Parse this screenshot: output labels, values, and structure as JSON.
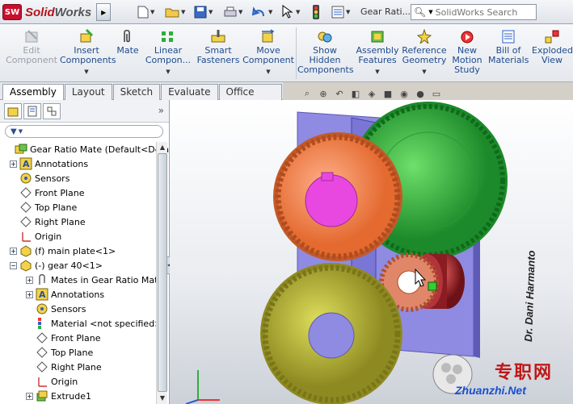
{
  "titlebar": {
    "logo_badge": "SW",
    "brand_main": "Solid",
    "brand_bold": "Works",
    "doc_title": "Gear Rati...",
    "search_placeholder": "SolidWorks Search"
  },
  "commands": [
    {
      "id": "edit-component",
      "label1": "Edit",
      "label2": "Component",
      "disabled": true
    },
    {
      "id": "insert-components",
      "label1": "Insert",
      "label2": "Components"
    },
    {
      "id": "mate",
      "label1": "Mate",
      "label2": ""
    },
    {
      "id": "linear-component",
      "label1": "Linear",
      "label2": "Compon..."
    },
    {
      "id": "smart-fasteners",
      "label1": "Smart",
      "label2": "Fasteners"
    },
    {
      "id": "move-component",
      "label1": "Move",
      "label2": "Component"
    },
    {
      "id": "show-hidden-components",
      "label1": "Show",
      "label2": "Hidden",
      "label3": "Components"
    },
    {
      "id": "assembly-features",
      "label1": "Assembly",
      "label2": "Features"
    },
    {
      "id": "reference-geometry",
      "label1": "Reference",
      "label2": "Geometry"
    },
    {
      "id": "new-motion-study",
      "label1": "New",
      "label2": "Motion",
      "label3": "Study"
    },
    {
      "id": "bill-of-materials",
      "label1": "Bill of",
      "label2": "Materials"
    },
    {
      "id": "exploded-view",
      "label1": "Exploded",
      "label2": "View"
    }
  ],
  "tabs": [
    "Assembly",
    "Layout",
    "Sketch",
    "Evaluate",
    "Office Products"
  ],
  "panel": {
    "collapse_glyph": "»"
  },
  "tree": [
    {
      "label": "Gear Ratio Mate  (Default<Default",
      "icon": "assembly",
      "indent": 0,
      "exp": ""
    },
    {
      "label": "Annotations",
      "icon": "annotation",
      "indent": 1,
      "exp": "+"
    },
    {
      "label": "Sensors",
      "icon": "sensor",
      "indent": 1,
      "exp": ""
    },
    {
      "label": "Front Plane",
      "icon": "plane",
      "indent": 1,
      "exp": ""
    },
    {
      "label": "Top Plane",
      "icon": "plane",
      "indent": 1,
      "exp": ""
    },
    {
      "label": "Right Plane",
      "icon": "plane",
      "indent": 1,
      "exp": ""
    },
    {
      "label": "Origin",
      "icon": "origin",
      "indent": 1,
      "exp": ""
    },
    {
      "label": "(f) main plate<1>",
      "icon": "part",
      "indent": 1,
      "exp": "+"
    },
    {
      "label": "(-) gear 40<1>",
      "icon": "part",
      "indent": 1,
      "exp": "−"
    },
    {
      "label": "Mates in Gear Ratio Mate",
      "icon": "mates",
      "indent": 2,
      "exp": "+"
    },
    {
      "label": "Annotations",
      "icon": "annotation",
      "indent": 2,
      "exp": "+"
    },
    {
      "label": "Sensors",
      "icon": "sensor",
      "indent": 2,
      "exp": ""
    },
    {
      "label": "Material <not specified>",
      "icon": "material",
      "indent": 2,
      "exp": ""
    },
    {
      "label": "Front Plane",
      "icon": "plane",
      "indent": 2,
      "exp": ""
    },
    {
      "label": "Top Plane",
      "icon": "plane",
      "indent": 2,
      "exp": ""
    },
    {
      "label": "Right Plane",
      "icon": "plane",
      "indent": 2,
      "exp": ""
    },
    {
      "label": "Origin",
      "icon": "origin",
      "indent": 2,
      "exp": ""
    },
    {
      "label": "Extrude1",
      "icon": "extrude",
      "indent": 2,
      "exp": "+"
    }
  ],
  "viewport": {
    "signature": "Dr. Dani Harmanto",
    "colors": {
      "gear_orange": "#f0844c",
      "gear_green": "#2fae3c",
      "gear_olive": "#b8b236",
      "gear_small": "#e0876a",
      "plate": "#8a86e0",
      "pinion": "#a4262c",
      "bore": "#e848e0"
    }
  },
  "watermark": {
    "main": "专职网",
    "sub": "Zhuanzhi.Net"
  }
}
